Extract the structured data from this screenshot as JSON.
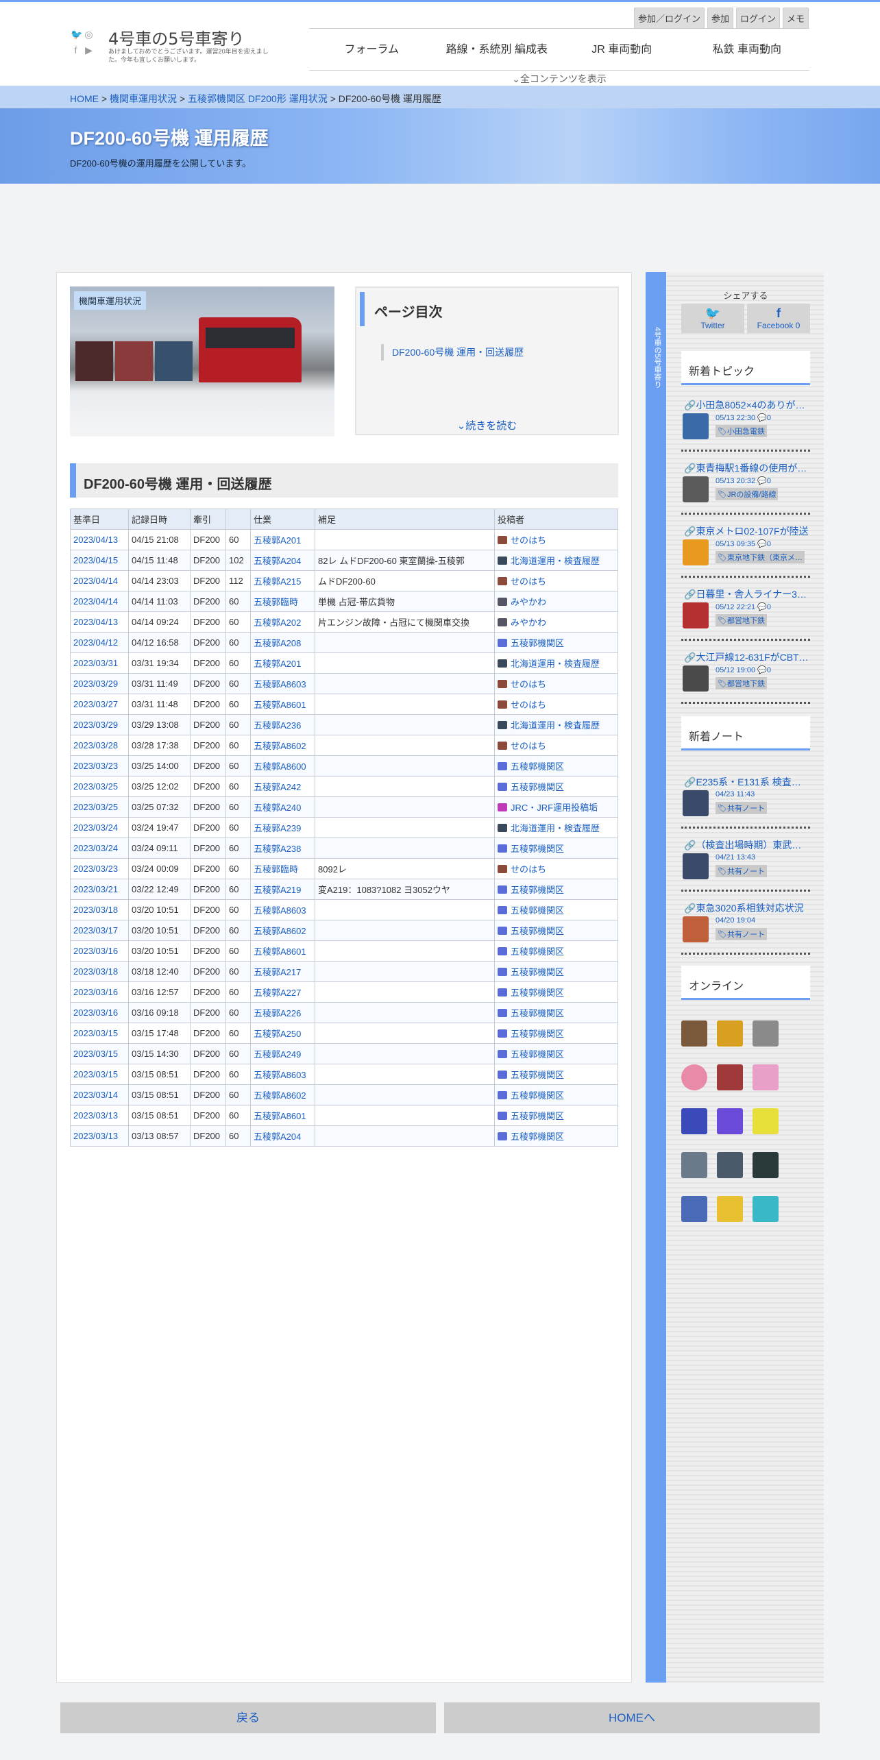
{
  "header": {
    "site_title": "4号車の5号車寄り",
    "site_sub": "あけましておめでとうございます。運営20年目を迎えました。今年も宜しくお願いします。",
    "auth": [
      "参加／ログイン",
      "参加",
      "ログイン",
      "メモ"
    ],
    "nav": [
      "フォーラム",
      "路線・系統別 編成表",
      "JR 車両動向",
      "私鉄 車両動向"
    ],
    "all_contents": "全コンテンツを表示"
  },
  "breadcrumb": {
    "home": "HOME",
    "l1": "機関車運用状況",
    "l2": "五稜郭機関区 DF200形 運用状況",
    "current": "DF200-60号機 運用履歴"
  },
  "page": {
    "title": "DF200-60号機 運用履歴",
    "subtitle": "DF200-60号機の運用履歴を公開しています。",
    "photo_tag": "機関車運用状況"
  },
  "toc": {
    "title": "ページ目次",
    "item": "DF200-60号機 運用・回送履歴",
    "more": "続きを読む"
  },
  "section": {
    "title": "DF200-60号機 運用・回送履歴"
  },
  "table": {
    "headers": [
      "基準日",
      "記録日時",
      "牽引",
      "",
      "仕業",
      "補足",
      "投稿者"
    ],
    "rows": [
      [
        "2023/04/13",
        "04/15 21:08",
        "DF200",
        "60",
        "五稜郭A201",
        "",
        "せのはち"
      ],
      [
        "2023/04/15",
        "04/15 11:48",
        "DF200",
        "102",
        "五稜郭A204",
        "82レ ムドDF200-60 東室蘭操-五稜郭",
        "北海道運用・検査履歴"
      ],
      [
        "2023/04/14",
        "04/14 23:03",
        "DF200",
        "112",
        "五稜郭A215",
        "ムドDF200-60",
        "せのはち"
      ],
      [
        "2023/04/14",
        "04/14 11:03",
        "DF200",
        "60",
        "五稜郭臨時",
        "単機 占冠-帯広貨物",
        "みやかわ"
      ],
      [
        "2023/04/13",
        "04/14 09:24",
        "DF200",
        "60",
        "五稜郭A202",
        "片エンジン故障・占冠にて機関車交換",
        "みやかわ"
      ],
      [
        "2023/04/12",
        "04/12 16:58",
        "DF200",
        "60",
        "五稜郭A208",
        "",
        "五稜郭機関区"
      ],
      [
        "2023/03/31",
        "03/31 19:34",
        "DF200",
        "60",
        "五稜郭A201",
        "",
        "北海道運用・検査履歴"
      ],
      [
        "2023/03/29",
        "03/31 11:49",
        "DF200",
        "60",
        "五稜郭A8603",
        "",
        "せのはち"
      ],
      [
        "2023/03/27",
        "03/31 11:48",
        "DF200",
        "60",
        "五稜郭A8601",
        "",
        "せのはち"
      ],
      [
        "2023/03/29",
        "03/29 13:08",
        "DF200",
        "60",
        "五稜郭A236",
        "",
        "北海道運用・検査履歴"
      ],
      [
        "2023/03/28",
        "03/28 17:38",
        "DF200",
        "60",
        "五稜郭A8602",
        "",
        "せのはち"
      ],
      [
        "2023/03/23",
        "03/25 14:00",
        "DF200",
        "60",
        "五稜郭A8600",
        "",
        "五稜郭機関区"
      ],
      [
        "2023/03/25",
        "03/25 12:02",
        "DF200",
        "60",
        "五稜郭A242",
        "",
        "五稜郭機関区"
      ],
      [
        "2023/03/25",
        "03/25 07:32",
        "DF200",
        "60",
        "五稜郭A240",
        "",
        "JRC・JRF運用投稿垢"
      ],
      [
        "2023/03/24",
        "03/24 19:47",
        "DF200",
        "60",
        "五稜郭A239",
        "",
        "北海道運用・検査履歴"
      ],
      [
        "2023/03/24",
        "03/24 09:11",
        "DF200",
        "60",
        "五稜郭A238",
        "",
        "五稜郭機関区"
      ],
      [
        "2023/03/23",
        "03/24 00:09",
        "DF200",
        "60",
        "五稜郭臨時",
        "8092レ",
        "せのはち"
      ],
      [
        "2023/03/21",
        "03/22 12:49",
        "DF200",
        "60",
        "五稜郭A219",
        "変A219：1083?1082 ヨ3052ウヤ",
        "五稜郭機関区"
      ],
      [
        "2023/03/18",
        "03/20 10:51",
        "DF200",
        "60",
        "五稜郭A8603",
        "",
        "五稜郭機関区"
      ],
      [
        "2023/03/17",
        "03/20 10:51",
        "DF200",
        "60",
        "五稜郭A8602",
        "",
        "五稜郭機関区"
      ],
      [
        "2023/03/16",
        "03/20 10:51",
        "DF200",
        "60",
        "五稜郭A8601",
        "",
        "五稜郭機関区"
      ],
      [
        "2023/03/18",
        "03/18 12:40",
        "DF200",
        "60",
        "五稜郭A217",
        "",
        "五稜郭機関区"
      ],
      [
        "2023/03/16",
        "03/16 12:57",
        "DF200",
        "60",
        "五稜郭A227",
        "",
        "五稜郭機関区"
      ],
      [
        "2023/03/16",
        "03/16 09:18",
        "DF200",
        "60",
        "五稜郭A226",
        "",
        "五稜郭機関区"
      ],
      [
        "2023/03/15",
        "03/15 17:48",
        "DF200",
        "60",
        "五稜郭A250",
        "",
        "五稜郭機関区"
      ],
      [
        "2023/03/15",
        "03/15 14:30",
        "DF200",
        "60",
        "五稜郭A249",
        "",
        "五稜郭機関区"
      ],
      [
        "2023/03/15",
        "03/15 08:51",
        "DF200",
        "60",
        "五稜郭A8603",
        "",
        "五稜郭機関区"
      ],
      [
        "2023/03/14",
        "03/15 08:51",
        "DF200",
        "60",
        "五稜郭A8602",
        "",
        "五稜郭機関区"
      ],
      [
        "2023/03/13",
        "03/15 08:51",
        "DF200",
        "60",
        "五稜郭A8601",
        "",
        "五稜郭機関区"
      ],
      [
        "2023/03/13",
        "03/13 08:57",
        "DF200",
        "60",
        "五稜郭A204",
        "",
        "五稜郭機関区"
      ]
    ]
  },
  "sidebar": {
    "strip_text": "4号車の5号車寄り",
    "share": "シェアする",
    "twitter": "Twitter",
    "facebook": "Facebook",
    "fb_count": "0",
    "topics_title": "新着トピック",
    "topics": [
      {
        "title": "小田急8052×4のありが…",
        "meta": "05/13 22:30 💬0",
        "cat": "小田急電鉄"
      },
      {
        "title": "東青梅駅1番線の使用が…",
        "meta": "05/13 20:32 💬0",
        "cat": "JRの設備/路線"
      },
      {
        "title": "東京メトロ02-107Fが陸送",
        "meta": "05/13 09:35 💬0",
        "cat": "東京地下鉄（東京メ…"
      },
      {
        "title": "日暮里・舎人ライナー3…",
        "meta": "05/12 22:21 💬0",
        "cat": "都営地下鉄"
      },
      {
        "title": "大江戸線12-631FがCBT…",
        "meta": "05/12 19:00 💬0",
        "cat": "都営地下鉄"
      }
    ],
    "notes_title": "新着ノート",
    "notes": [
      {
        "title": "E235系・E131系 検査…",
        "meta": "04/23 11:43",
        "cat": "共有ノート"
      },
      {
        "title": "（検査出場時期）東武…",
        "meta": "04/21 13:43",
        "cat": "共有ノート"
      },
      {
        "title": "東急3020系相鉄対応状況",
        "meta": "04/20 19:04",
        "cat": "共有ノート"
      }
    ],
    "online_title": "オンライン"
  },
  "footer": {
    "back": "戻る",
    "home": "HOMEへ"
  }
}
